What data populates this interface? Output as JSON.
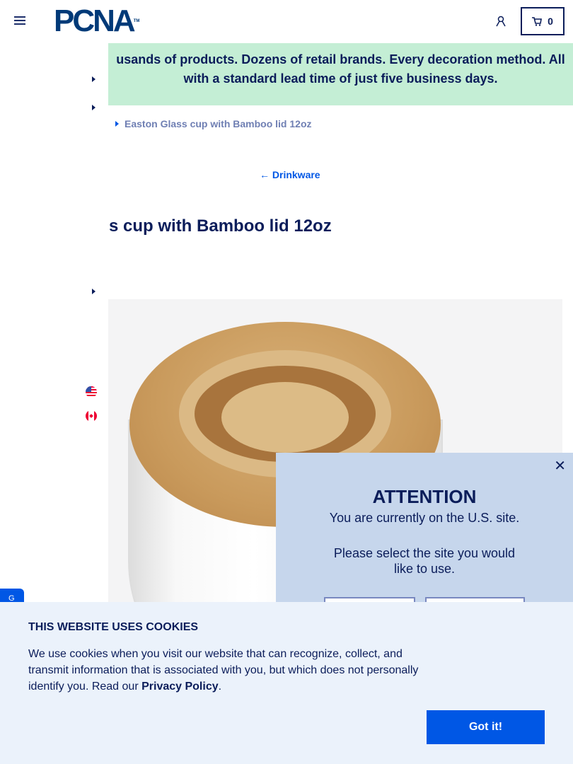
{
  "header": {
    "logo": "PCNA",
    "logo_tm": "TM",
    "cart_count": "0"
  },
  "banner": {
    "line1": "usands of products. Dozens of retail brands. Every decoration method. All",
    "line2": "with a standard lead time of just five business days."
  },
  "breadcrumb": {
    "current": "Easton Glass cup with Bamboo lid 12oz"
  },
  "back_link": "← Drinkware",
  "product": {
    "title": "s cup with Bamboo lid 12oz"
  },
  "modal": {
    "close": "✕",
    "title": "ATTENTION",
    "message": "You are currently on the U.S. site.",
    "prompt": "Please select the site you would like to use."
  },
  "feedback": {
    "icon": "feedback-icon"
  },
  "cookie": {
    "title": "THIS WEBSITE USES COOKIES",
    "text": "We use cookies when you visit our website that can recognize, collect, and transmit information that is associated with you, but which does not personally identify you. Read our ",
    "link": "Privacy Policy",
    "end": ".",
    "button": "Got it!"
  },
  "colors": {
    "navy": "#0b1d5a",
    "accent": "#0057e5",
    "banner": "#c4eed5",
    "modal": "#c6d6ec",
    "cookie": "#ebf2fb"
  }
}
